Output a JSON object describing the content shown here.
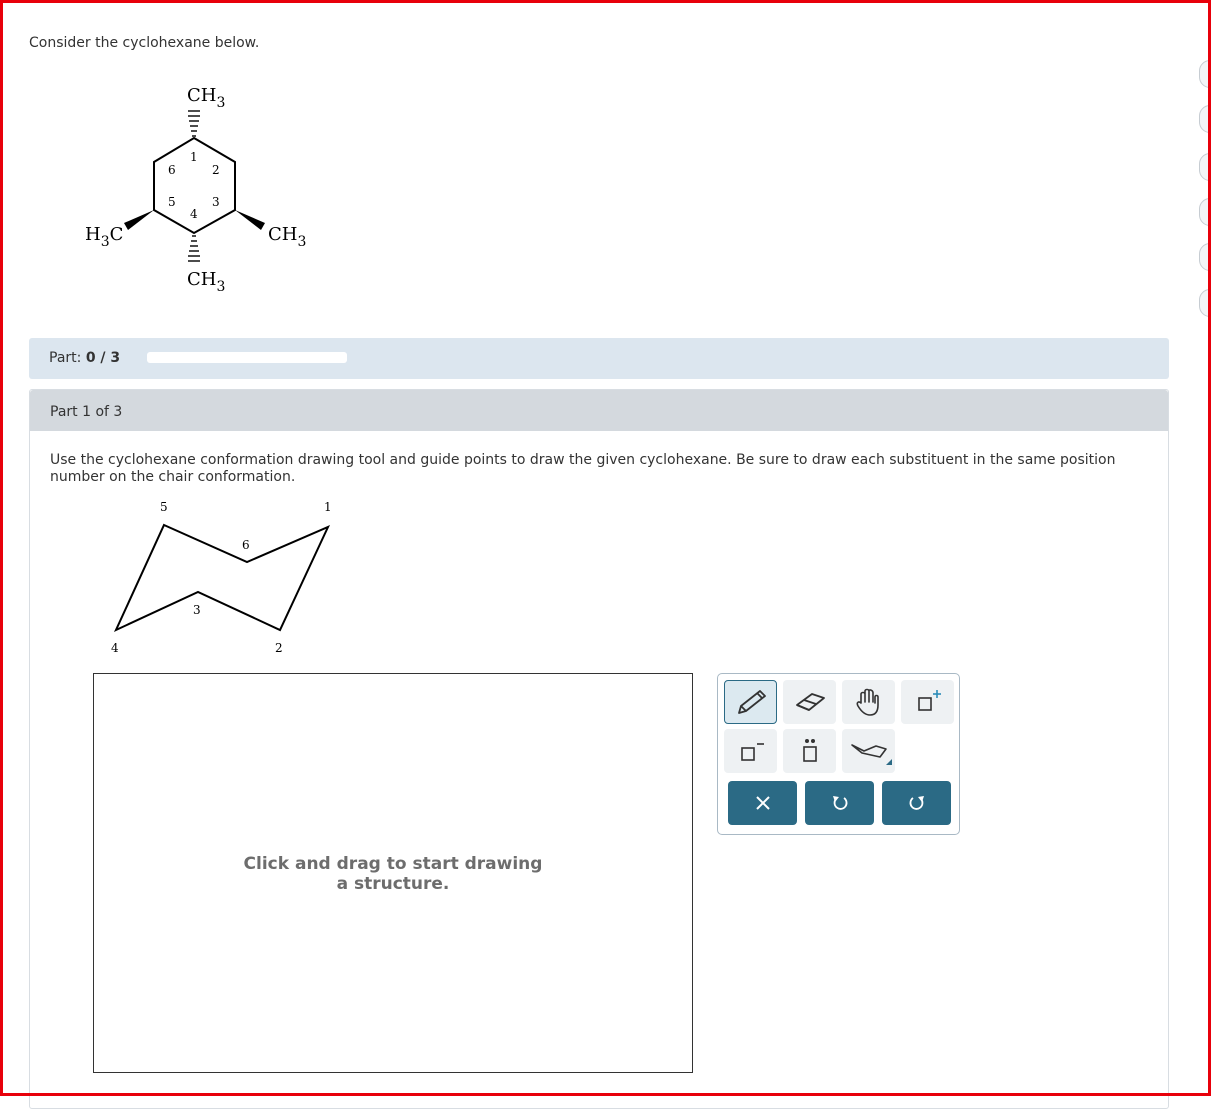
{
  "question": {
    "prompt": "Consider the cyclohexane below."
  },
  "molecule": {
    "top_group": "CH",
    "top_sub": "3",
    "left_group_h": "H",
    "left_group_sub": "3",
    "left_group_c": "C",
    "right_group": "CH",
    "right_sub": "3",
    "bottom_group": "CH",
    "bottom_sub": "3",
    "ring_numbers": [
      "1",
      "2",
      "3",
      "4",
      "5",
      "6"
    ]
  },
  "progress": {
    "label": "Part:",
    "value": "0 / 3",
    "fraction": 0
  },
  "part": {
    "header": "Part 1 of 3",
    "instructions": "Use the cyclohexane conformation drawing tool and guide points to draw the given cyclohexane. Be sure to draw each substituent in the same position number on the chair conformation."
  },
  "chair": {
    "numbers": [
      "1",
      "2",
      "3",
      "4",
      "5",
      "6"
    ]
  },
  "canvas": {
    "hint": "Click and drag to start drawing a structure."
  },
  "toolbar": {
    "tools": [
      "pencil-icon",
      "eraser-icon",
      "hand-icon",
      "add-charge-icon",
      "remove-charge-icon",
      "lone-pair-icon",
      "cyclohexane-template-icon"
    ],
    "actions": [
      "clear-icon",
      "undo-icon",
      "redo-icon"
    ],
    "accent_color": "#2b6a85"
  },
  "colors": {
    "frame": "#e8000b",
    "part_bar": "#dce6ef",
    "part_header": "#d4d9de"
  }
}
